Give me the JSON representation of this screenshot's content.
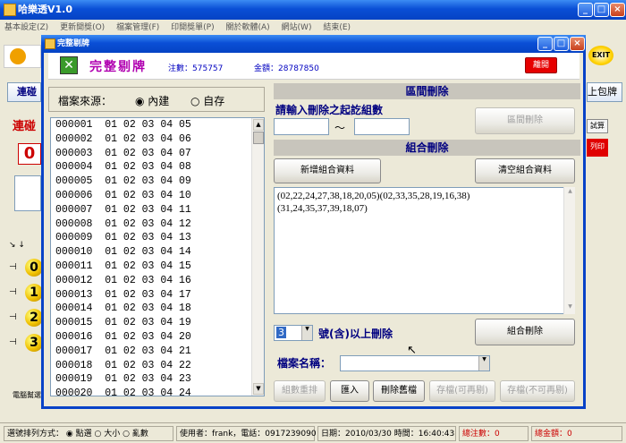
{
  "app": {
    "title": "哈樂透V1.0",
    "menu": [
      "基本設定(Z)",
      "更新開獎(O)",
      "檔案管理(F)",
      "印開獎單(P)",
      "關於軟體(A)",
      "網站(W)",
      "結束(E)"
    ],
    "exit_label": "EXIT",
    "tab_label": "連碰",
    "right_tab_label": "上包牌",
    "right_btn_label": "試算",
    "right_print_label": "列印",
    "left_snippet": "連碰",
    "left_count": "0",
    "balls": [
      "0",
      "1",
      "2",
      "3"
    ],
    "bottom_left_label": "電腦幫選",
    "status": {
      "sort_label": "選號排列方式：",
      "sort_options": [
        "點選",
        "大小",
        "亂數"
      ],
      "user_info": "使用者：frank，電話：0917239090",
      "date_label": "日期：",
      "date": "2010/03/30",
      "time_label": "時間：",
      "time": "16:40:43",
      "total_count_label": "總注數：",
      "total_count": "0",
      "total_amount_label": "總金額：",
      "total_amount": "0"
    }
  },
  "dialog": {
    "title": "完整剔牌",
    "header_title": "完整剔牌",
    "count_label": "注數：",
    "count_value": "575757",
    "amount_label": "金額：",
    "amount_value": "28787850",
    "leave_button": "離開",
    "source": {
      "label": "檔案來源：",
      "options": [
        "內建",
        "自存"
      ],
      "selected": "內建"
    },
    "list_rows": [
      "000001  01 02 03 04 05",
      "000002  01 02 03 04 06",
      "000003  01 02 03 04 07",
      "000004  01 02 03 04 08",
      "000005  01 02 03 04 09",
      "000006  01 02 03 04 10",
      "000007  01 02 03 04 11",
      "000008  01 02 03 04 12",
      "000009  01 02 03 04 13",
      "000010  01 02 03 04 14",
      "000011  01 02 03 04 15",
      "000012  01 02 03 04 16",
      "000013  01 02 03 04 17",
      "000014  01 02 03 04 18",
      "000015  01 02 03 04 19",
      "000016  01 02 03 04 20",
      "000017  01 02 03 04 21",
      "000018  01 02 03 04 22",
      "000019  01 02 03 04 23",
      "000020  01 02 03 04 24"
    ],
    "range": {
      "section_title": "區間刪除",
      "prompt": "請輸入刪除之起訖組數",
      "separator": "～",
      "from_value": "",
      "to_value": "",
      "delete_button": "區間刪除"
    },
    "combo": {
      "section_title": "組合刪除",
      "add_button": "新增組合資料",
      "clear_button": "清空組合資料",
      "text": "(02,22,24,27,38,18,20,05)(02,33,35,28,19,16,38)\n(31,24,35,37,39,18,07)",
      "count_value": "3",
      "count_suffix": "號(含)以上刪除",
      "delete_button": "組合刪除",
      "filename_label": "檔案名稱：",
      "filename_value": ""
    },
    "bottom_buttons": [
      "組數重排",
      "匯入",
      "刪除舊檔",
      "存檔(可再剔)",
      "存檔(不可再剔)"
    ]
  }
}
